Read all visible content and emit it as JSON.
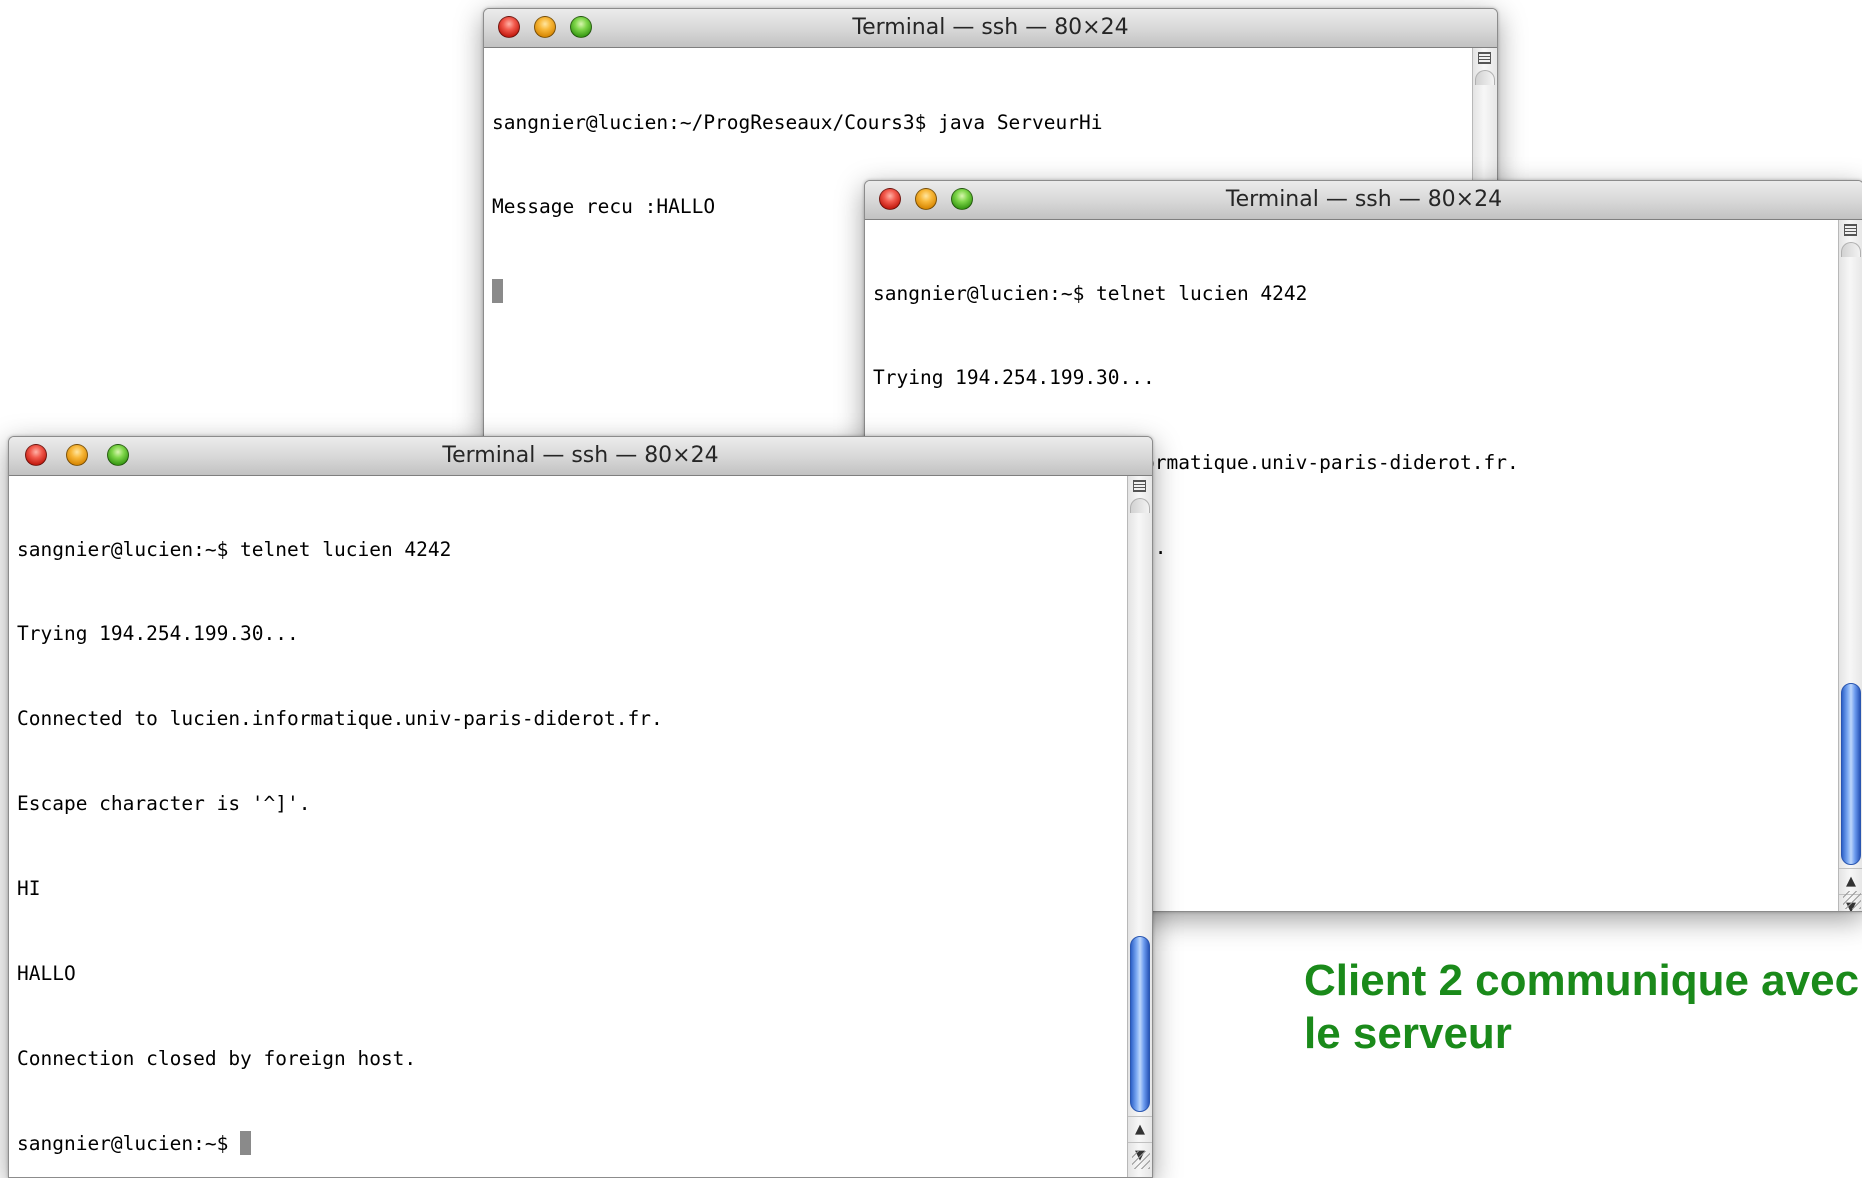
{
  "windows": {
    "server": {
      "title": "Terminal — ssh — 80×24",
      "lines": [
        "sangnier@lucien:~/ProgReseaux/Cours3$ java ServeurHi",
        "Message recu :HALLO",
        ""
      ]
    },
    "client1": {
      "title": "Terminal — ssh — 80×24",
      "lines": [
        "sangnier@lucien:~$ telnet lucien 4242",
        "Trying 194.254.199.30...",
        "Connected to lucien.informatique.univ-paris-diderot.fr.",
        "Escape character is '^]'.",
        "HI",
        ""
      ]
    },
    "client2": {
      "title": "Terminal — ssh — 80×24",
      "lines": [
        "sangnier@lucien:~$ telnet lucien 4242",
        "Trying 194.254.199.30...",
        "Connected to lucien.informatique.univ-paris-diderot.fr.",
        "Escape character is '^]'.",
        "HI",
        "HALLO",
        "Connection closed by foreign host.",
        "sangnier@lucien:~$ "
      ]
    }
  },
  "scrollbar": {
    "up_arrow": "▲",
    "down_arrow": "▼"
  },
  "caption": {
    "line1": "Client 2 communique avec",
    "line2": "le serveur"
  },
  "colors": {
    "caption": "#1a8a1a",
    "scroll_thumb": "#3a6fd8",
    "cursor": "#8a8a8a"
  },
  "icons": [
    "close-button-icon",
    "minimize-button-icon",
    "zoom-button-icon",
    "split-pane-icon",
    "resize-grip-icon"
  ]
}
